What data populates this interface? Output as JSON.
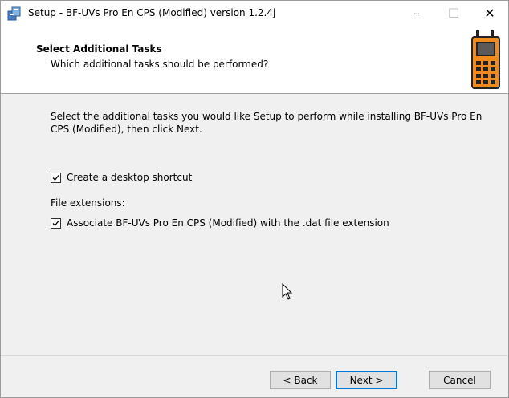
{
  "window": {
    "title": "Setup - BF-UVs Pro En CPS (Modified) version 1.2.4j",
    "controls": {
      "minimize": "–",
      "maximize": "☐",
      "close": "✕"
    }
  },
  "header": {
    "title": "Select Additional Tasks",
    "subtitle": "Which additional tasks should be performed?"
  },
  "main": {
    "description": "Select the additional tasks you would like Setup to perform while installing BF-UVs Pro En CPS (Modified), then click Next.",
    "tasks": [
      {
        "label": "Create a desktop shortcut",
        "checked": true
      }
    ],
    "file_extensions_label": "File extensions:",
    "file_tasks": [
      {
        "label": "Associate BF-UVs Pro En CPS (Modified) with the .dat file extension",
        "checked": true
      }
    ]
  },
  "footer": {
    "back_label": "< Back",
    "next_label": "Next >",
    "cancel_label": "Cancel"
  },
  "colors": {
    "accent": "#0078d7",
    "radio_orange": "#f08a1c"
  }
}
